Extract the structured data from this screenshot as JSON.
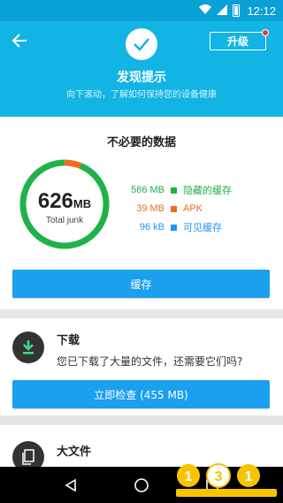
{
  "statusbar": {
    "time": "12:12"
  },
  "header": {
    "upgrade_label": "升级",
    "title": "发现提示",
    "subtitle": "向下滚动，了解如何保持您的设备健康"
  },
  "junk_card": {
    "title": "不必要的数据",
    "total_value": "626",
    "total_unit": "MB",
    "total_label": "Total junk",
    "items": [
      {
        "value": "586 MB",
        "label": "隐藏的缓存",
        "color": "#1fb24a"
      },
      {
        "value": "39 MB",
        "label": "APK",
        "color": "#f26b21"
      },
      {
        "value": "96 kB",
        "label": "可见缓存",
        "color": "#2196f3"
      }
    ],
    "ring_fractions": {
      "hidden_cache": 0.936,
      "apk": 0.062,
      "visible_cache": 0.002
    },
    "button_label": "缓存"
  },
  "download_card": {
    "title": "下载",
    "text": "您已下载了大量的文件，还需要它们吗?",
    "button_label": "立即检查 (455 MB)"
  },
  "large_files_card": {
    "title": "大文件"
  },
  "colors": {
    "header": "#12b4e4",
    "button": "#1aa0ee",
    "green": "#1fb24a",
    "orange": "#f26b21",
    "blue": "#2196f3"
  },
  "watermark": {
    "text": "一号手游 1e31.com"
  }
}
